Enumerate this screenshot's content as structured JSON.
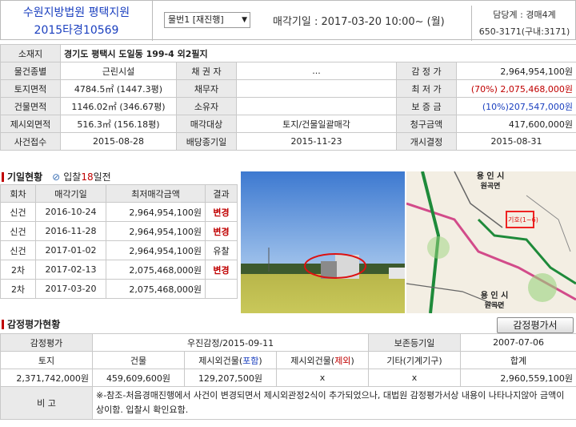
{
  "header": {
    "court": "수원지방법원 평택지원",
    "case_no": "2015타경10569",
    "item_select": "물번1 [재진행]",
    "sale_date": "매각기일 : 2017-03-20   10:00~ (월)",
    "contact_line1": "담당계 : 경매4계",
    "contact_line2": "650-3171(구내:3171)"
  },
  "info": {
    "address_label": "소재지",
    "address": "경기도 평택시 도일동 199-4 외2필지",
    "rows": [
      [
        "물건종별",
        "근린시설",
        "채 권 자",
        "...",
        "감 정 가",
        "2,964,954,100원"
      ],
      [
        "토지면적",
        "4784.5㎡ (1447.3평)",
        "채무자",
        "",
        "최 저 가",
        "(70%) 2,075,468,000원"
      ],
      [
        "건물면적",
        "1146.02㎡ (346.67평)",
        "소유자",
        "",
        "보 증 금",
        "(10%)207,547,000원"
      ],
      [
        "제시외면적",
        "516.3㎡ (156.18평)",
        "매각대상",
        "토지/건물일괄매각",
        "청구금액",
        "417,600,000원"
      ],
      [
        "사건접수",
        "2015-08-28",
        "배당종기일",
        "2015-11-23",
        "개시결정",
        "2015-08-31"
      ]
    ]
  },
  "history": {
    "title": "기일현황",
    "bid_note_pre": "입찰",
    "bid_days": "18",
    "bid_note_post": "일전",
    "headers": [
      "회차",
      "매각기일",
      "최저매각금액",
      "결과"
    ],
    "rows": [
      [
        "신건",
        "2016-10-24",
        "2,964,954,100원",
        "변경"
      ],
      [
        "신건",
        "2016-11-28",
        "2,964,954,100원",
        "변경"
      ],
      [
        "신건",
        "2017-01-02",
        "2,964,954,100원",
        "유찰"
      ],
      [
        "2차",
        "2017-02-13",
        "2,075,468,000원",
        "변경"
      ],
      [
        "2차",
        "2017-03-20",
        "2,075,468,000원",
        ""
      ]
    ]
  },
  "map": {
    "place_top": "용 인 시",
    "place_top2": "원곡면",
    "marker": "기호(1~6)",
    "place_bottom": "용 인 시",
    "place_bottom2": "원곡면"
  },
  "appraisal": {
    "title": "감정평가현황",
    "button": "감정평가서",
    "row1": [
      "감정평가",
      "우진감정/2015-09-11",
      "보존등기일",
      "2007-07-06"
    ],
    "headers": {
      "land": "토지",
      "building": "건물",
      "incl_pre": "제시외건물(",
      "incl": "포함",
      "incl_post": ")",
      "excl_pre": "제시외건물(",
      "excl": "제외",
      "excl_post": ")",
      "etc": "기타(기계기구)",
      "total": "합계"
    },
    "values": [
      "2,371,742,000원",
      "459,609,600원",
      "129,207,500원",
      "x",
      "x",
      "2,960,559,100원"
    ],
    "remark_label": "비 고",
    "remark": "※-참조-처음경매진행에서 사건이 변경되면서 제시외관정2식이 추가되었으나, 대법원 감정평가서상 내용이 나타나지않아 금액이 상이함. 입찰시 확인요함."
  }
}
